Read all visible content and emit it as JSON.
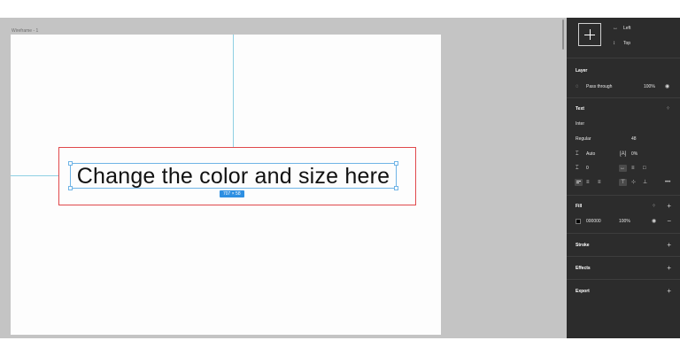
{
  "canvas": {
    "frame_label": "Wireframe - 1",
    "text_content": "Change the color and size here",
    "size_badge": "707 × 58"
  },
  "panel": {
    "constraints": {
      "horizontal": "Left",
      "vertical": "Top"
    },
    "layer": {
      "title": "Layer",
      "blend_mode": "Pass through",
      "opacity": "100%"
    },
    "text": {
      "title": "Text",
      "font_family": "Inter",
      "font_style": "Regular",
      "font_size": "48",
      "line_height": "Auto",
      "letter_spacing": "0%",
      "paragraph_spacing": "0"
    },
    "fill": {
      "title": "Fill",
      "hex": "000000",
      "opacity": "100%",
      "color": "#000000"
    },
    "stroke": {
      "title": "Stroke"
    },
    "effects": {
      "title": "Effects"
    },
    "export": {
      "title": "Export"
    }
  },
  "colors": {
    "canvas_bg": "#c4c4c4",
    "panel_bg": "#2c2c2c",
    "highlight_box": "#e0494c",
    "selection": "#2e8fe2"
  },
  "icons": [
    "eye-icon",
    "grid-dots-icon",
    "plus-icon",
    "minus-icon",
    "more-icon",
    "constraint-icon"
  ]
}
